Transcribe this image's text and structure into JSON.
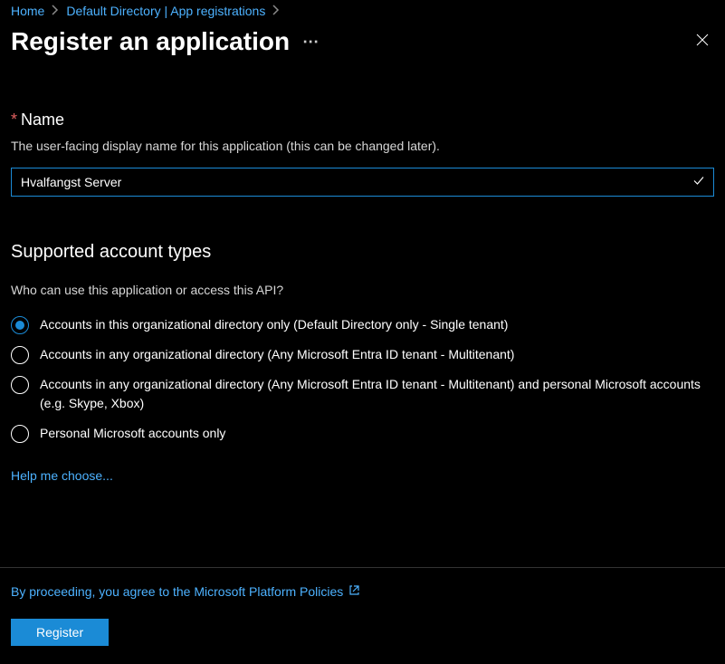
{
  "breadcrumb": {
    "home": "Home",
    "directory": "Default Directory | App registrations"
  },
  "page_title": "Register an application",
  "name_field": {
    "label": "Name",
    "help": "The user-facing display name for this application (this can be changed later).",
    "value": "Hvalfangst Server"
  },
  "account_types": {
    "title": "Supported account types",
    "help": "Who can use this application or access this API?",
    "options": [
      "Accounts in this organizational directory only (Default Directory only - Single tenant)",
      "Accounts in any organizational directory (Any Microsoft Entra ID tenant - Multitenant)",
      "Accounts in any organizational directory (Any Microsoft Entra ID tenant - Multitenant) and personal Microsoft accounts (e.g. Skype, Xbox)",
      "Personal Microsoft accounts only"
    ],
    "help_link": "Help me choose..."
  },
  "footer": {
    "policy_text": "By proceeding, you agree to the Microsoft Platform Policies",
    "register_label": "Register"
  }
}
